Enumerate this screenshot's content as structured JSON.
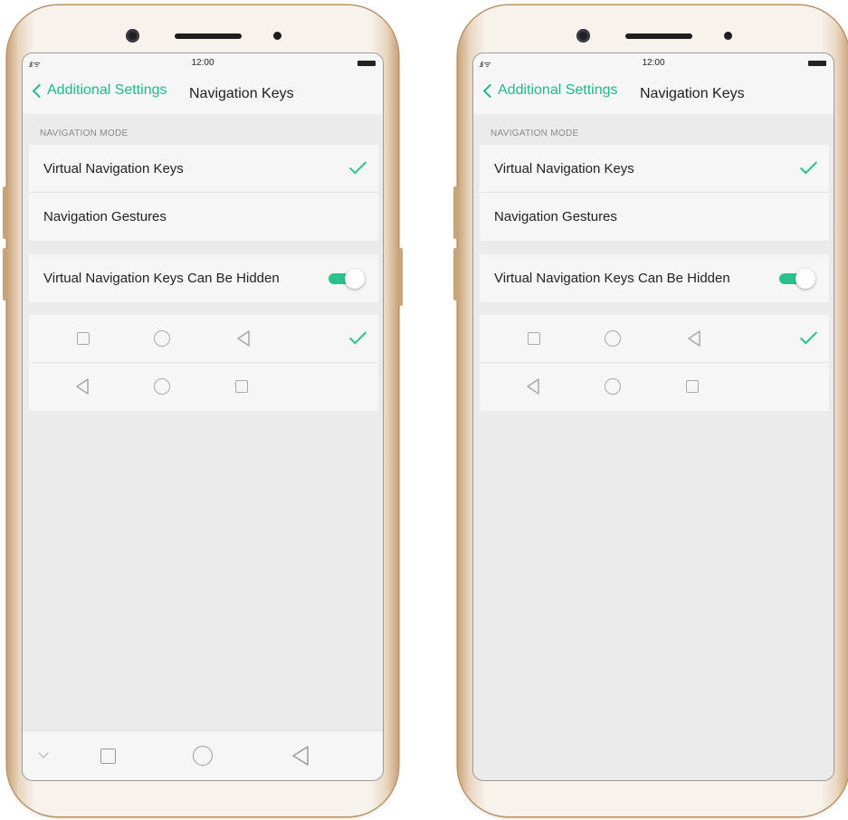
{
  "phones": [
    {
      "status": {
        "time": "12:00"
      },
      "header": {
        "back_label": "Additional Settings",
        "title": "Navigation Keys"
      },
      "section_label": "NAVIGATION MODE",
      "mode_options": [
        {
          "label": "Virtual Navigation Keys",
          "selected": true
        },
        {
          "label": "Navigation Gestures",
          "selected": false
        }
      ],
      "hide_keys": {
        "label": "Virtual Navigation Keys Can Be Hidden",
        "on": true
      },
      "key_layouts": [
        {
          "keys": [
            "square-icon",
            "circle-icon",
            "back-triangle-icon"
          ],
          "selected": true
        },
        {
          "keys": [
            "back-triangle-icon",
            "circle-icon",
            "square-icon"
          ],
          "selected": false
        }
      ],
      "system_nav_visible": true
    },
    {
      "status": {
        "time": "12:00"
      },
      "header": {
        "back_label": "Additional Settings",
        "title": "Navigation Keys"
      },
      "section_label": "NAVIGATION MODE",
      "mode_options": [
        {
          "label": "Virtual Navigation Keys",
          "selected": true
        },
        {
          "label": "Navigation Gestures",
          "selected": false
        }
      ],
      "hide_keys": {
        "label": "Virtual Navigation Keys Can Be Hidden",
        "on": true
      },
      "key_layouts": [
        {
          "keys": [
            "square-icon",
            "circle-icon",
            "back-triangle-icon"
          ],
          "selected": true
        },
        {
          "keys": [
            "back-triangle-icon",
            "circle-icon",
            "square-icon"
          ],
          "selected": false
        }
      ],
      "system_nav_visible": false
    }
  ],
  "colors": {
    "accent": "#29c28d",
    "link": "#1fb989",
    "background": "#ebebeb",
    "card": "#f6f6f6"
  }
}
